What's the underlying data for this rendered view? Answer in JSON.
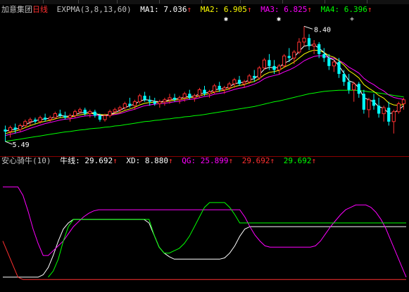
{
  "upper_header": {
    "stock_name": "加意集团",
    "period": "日线",
    "indicator": "EXPMA(3,8,13,60)",
    "ma1": "MA1: 7.036",
    "ma2": "MA2: 6.905",
    "ma3": "MA3: 6.825",
    "ma4": "MA4: 6.396",
    "colors": {
      "name": "#c0c0c0",
      "period": "#ff3030",
      "ma1": "#ffffff",
      "ma2": "#ffff00",
      "ma3": "#ff00ff",
      "ma4": "#00ff00",
      "arrow": "#ff3030"
    }
  },
  "price_labels": {
    "high": "8.40",
    "low": "5.49"
  },
  "lower_header": {
    "indicator": "安心骑牛(10)",
    "niu": "牛线: 29.692",
    "xd": "XD: 8.880",
    "qg": "QG: 25.899",
    "v4": "29.692",
    "v5": "29.692",
    "colors": {
      "name": "#c0c0c0",
      "niu": "#ffffff",
      "xd": "#ffffff",
      "qg": "#ff00ff",
      "v4": "#ff3030",
      "v5": "#00ff00"
    }
  },
  "chart_data": [
    {
      "type": "candlestick",
      "ylim": [
        5.2,
        8.6
      ],
      "high_label": 8.4,
      "low_label": 5.49,
      "series": [
        {
          "name": "MA1",
          "color": "#ffffff"
        },
        {
          "name": "MA2",
          "color": "#ffff00"
        },
        {
          "name": "MA3",
          "color": "#ff00ff"
        },
        {
          "name": "MA4",
          "color": "#00ff00"
        }
      ],
      "candles": [
        [
          5.8,
          5.9,
          5.5,
          5.75
        ],
        [
          5.75,
          5.9,
          5.6,
          5.85
        ],
        [
          5.85,
          5.95,
          5.7,
          5.8
        ],
        [
          5.8,
          5.95,
          5.75,
          5.9
        ],
        [
          5.9,
          6.05,
          5.85,
          6.0
        ],
        [
          6.0,
          6.1,
          5.9,
          6.05
        ],
        [
          6.05,
          6.1,
          5.95,
          6.0
        ],
        [
          6.0,
          6.15,
          5.95,
          6.1
        ],
        [
          6.1,
          6.2,
          6.0,
          6.05
        ],
        [
          6.05,
          6.15,
          6.0,
          6.1
        ],
        [
          6.1,
          6.25,
          6.05,
          6.2
        ],
        [
          6.2,
          6.3,
          6.1,
          6.15
        ],
        [
          6.15,
          6.25,
          6.05,
          6.1
        ],
        [
          6.1,
          6.2,
          6.0,
          6.15
        ],
        [
          6.15,
          6.3,
          6.1,
          6.25
        ],
        [
          6.25,
          6.35,
          6.2,
          6.3
        ],
        [
          6.3,
          6.35,
          6.15,
          6.2
        ],
        [
          6.2,
          6.3,
          6.1,
          6.25
        ],
        [
          6.25,
          6.3,
          6.1,
          6.15
        ],
        [
          6.15,
          6.2,
          6.0,
          6.05
        ],
        [
          6.05,
          6.2,
          6.0,
          6.15
        ],
        [
          6.15,
          6.3,
          6.1,
          6.25
        ],
        [
          6.25,
          6.35,
          6.2,
          6.3
        ],
        [
          6.3,
          6.4,
          6.2,
          6.35
        ],
        [
          6.35,
          6.5,
          6.3,
          6.45
        ],
        [
          6.45,
          6.6,
          6.35,
          6.4
        ],
        [
          6.4,
          6.55,
          6.3,
          6.5
        ],
        [
          6.5,
          6.7,
          6.45,
          6.65
        ],
        [
          6.65,
          6.75,
          6.5,
          6.55
        ],
        [
          6.55,
          6.65,
          6.4,
          6.5
        ],
        [
          6.5,
          6.6,
          6.4,
          6.45
        ],
        [
          6.45,
          6.55,
          6.35,
          6.5
        ],
        [
          6.5,
          6.6,
          6.4,
          6.55
        ],
        [
          6.55,
          6.7,
          6.45,
          6.6
        ],
        [
          6.6,
          6.7,
          6.5,
          6.55
        ],
        [
          6.55,
          6.65,
          6.45,
          6.6
        ],
        [
          6.6,
          6.75,
          6.5,
          6.7
        ],
        [
          6.7,
          6.8,
          6.55,
          6.6
        ],
        [
          6.6,
          6.7,
          6.5,
          6.65
        ],
        [
          6.65,
          6.85,
          6.6,
          6.8
        ],
        [
          6.8,
          6.9,
          6.65,
          6.7
        ],
        [
          6.7,
          6.8,
          6.6,
          6.75
        ],
        [
          6.75,
          6.95,
          6.7,
          6.9
        ],
        [
          6.9,
          7.0,
          6.75,
          6.8
        ],
        [
          6.8,
          6.9,
          6.7,
          6.85
        ],
        [
          6.85,
          7.0,
          6.8,
          6.95
        ],
        [
          6.95,
          7.1,
          6.85,
          7.05
        ],
        [
          7.05,
          7.15,
          6.9,
          6.95
        ],
        [
          6.95,
          7.05,
          6.85,
          7.0
        ],
        [
          7.0,
          7.2,
          6.95,
          7.15
        ],
        [
          7.15,
          7.3,
          7.0,
          7.1
        ],
        [
          7.1,
          7.4,
          7.05,
          7.35
        ],
        [
          7.35,
          7.6,
          7.3,
          7.55
        ],
        [
          7.55,
          7.7,
          7.3,
          7.4
        ],
        [
          7.4,
          7.55,
          7.2,
          7.3
        ],
        [
          7.3,
          7.45,
          7.2,
          7.4
        ],
        [
          7.4,
          7.7,
          7.35,
          7.65
        ],
        [
          7.65,
          7.85,
          7.5,
          7.6
        ],
        [
          7.6,
          7.8,
          7.45,
          7.75
        ],
        [
          7.75,
          8.1,
          7.7,
          8.0
        ],
        [
          8.0,
          8.4,
          7.9,
          8.1
        ],
        [
          8.1,
          8.2,
          7.8,
          7.9
        ],
        [
          7.9,
          8.05,
          7.7,
          7.95
        ],
        [
          7.95,
          8.0,
          7.6,
          7.7
        ],
        [
          7.7,
          7.85,
          7.5,
          7.6
        ],
        [
          7.6,
          7.7,
          7.3,
          7.4
        ],
        [
          7.4,
          7.55,
          7.25,
          7.5
        ],
        [
          7.5,
          7.6,
          7.1,
          7.2
        ],
        [
          7.2,
          7.3,
          6.9,
          7.0
        ],
        [
          7.0,
          7.2,
          6.7,
          6.8
        ],
        [
          6.8,
          7.0,
          6.5,
          6.95
        ],
        [
          6.95,
          7.0,
          6.6,
          6.7
        ],
        [
          6.7,
          6.8,
          6.2,
          6.3
        ],
        [
          6.3,
          6.6,
          6.1,
          6.55
        ],
        [
          6.55,
          6.7,
          6.3,
          6.4
        ],
        [
          6.4,
          6.6,
          6.1,
          6.2
        ],
        [
          6.2,
          6.4,
          6.0,
          6.35
        ],
        [
          6.35,
          6.5,
          5.9,
          6.0
        ],
        [
          6.0,
          6.3,
          5.7,
          6.25
        ],
        [
          6.25,
          6.5,
          6.2,
          6.45
        ],
        [
          6.45,
          6.6,
          6.3,
          6.55
        ]
      ],
      "ma1": [
        5.75,
        5.8,
        5.8,
        5.85,
        5.92,
        5.98,
        6.02,
        6.05,
        6.07,
        6.08,
        6.12,
        6.15,
        6.14,
        6.13,
        6.17,
        6.22,
        6.23,
        6.23,
        6.21,
        6.16,
        6.15,
        6.18,
        6.23,
        6.28,
        6.35,
        6.4,
        6.44,
        6.52,
        6.55,
        6.54,
        6.51,
        6.5,
        6.51,
        6.55,
        6.57,
        6.58,
        6.62,
        6.63,
        6.64,
        6.7,
        6.72,
        6.74,
        6.8,
        6.82,
        6.83,
        6.88,
        6.95,
        6.98,
        6.99,
        7.05,
        7.08,
        7.18,
        7.32,
        7.37,
        7.35,
        7.37,
        7.47,
        7.53,
        7.62,
        7.77,
        7.9,
        7.92,
        7.93,
        7.85,
        7.74,
        7.6,
        7.55,
        7.4,
        7.22,
        7.03,
        6.98,
        6.85,
        6.6,
        6.55,
        6.5,
        6.37,
        6.34,
        6.2,
        6.22,
        6.3,
        6.4
      ],
      "ma2": [
        5.7,
        5.73,
        5.76,
        5.8,
        5.85,
        5.9,
        5.94,
        5.98,
        6.01,
        6.03,
        6.07,
        6.1,
        6.11,
        6.11,
        6.14,
        6.17,
        6.19,
        6.2,
        6.2,
        6.18,
        6.17,
        6.18,
        6.2,
        6.23,
        6.28,
        6.32,
        6.36,
        6.42,
        6.46,
        6.48,
        6.49,
        6.49,
        6.5,
        6.52,
        6.54,
        6.55,
        6.58,
        6.6,
        6.61,
        6.65,
        6.68,
        6.7,
        6.74,
        6.77,
        6.79,
        6.83,
        6.88,
        6.91,
        6.93,
        6.98,
        7.01,
        7.08,
        7.18,
        7.24,
        7.26,
        7.29,
        7.37,
        7.43,
        7.5,
        7.6,
        7.7,
        7.76,
        7.8,
        7.79,
        7.74,
        7.66,
        7.62,
        7.53,
        7.42,
        7.28,
        7.2,
        7.1,
        6.93,
        6.84,
        6.76,
        6.66,
        6.59,
        6.47,
        6.42,
        6.41,
        6.43
      ],
      "ma3": [
        5.65,
        5.68,
        5.71,
        5.74,
        5.78,
        5.83,
        5.87,
        5.91,
        5.95,
        5.98,
        6.01,
        6.04,
        6.06,
        6.07,
        6.09,
        6.12,
        6.14,
        6.15,
        6.16,
        6.15,
        6.15,
        6.16,
        6.18,
        6.2,
        6.24,
        6.28,
        6.31,
        6.36,
        6.4,
        6.42,
        6.44,
        6.45,
        6.46,
        6.48,
        6.5,
        6.51,
        6.54,
        6.56,
        6.57,
        6.6,
        6.63,
        6.65,
        6.69,
        6.71,
        6.73,
        6.77,
        6.81,
        6.84,
        6.86,
        6.9,
        6.94,
        7.0,
        7.08,
        7.13,
        7.16,
        7.19,
        7.25,
        7.3,
        7.36,
        7.44,
        7.53,
        7.59,
        7.64,
        7.66,
        7.65,
        7.61,
        7.59,
        7.54,
        7.47,
        7.37,
        7.3,
        7.22,
        7.09,
        7.0,
        6.93,
        6.84,
        6.77,
        6.67,
        6.61,
        6.58,
        6.56
      ],
      "ma4": [
        5.5,
        5.52,
        5.54,
        5.56,
        5.58,
        5.6,
        5.62,
        5.64,
        5.66,
        5.68,
        5.7,
        5.72,
        5.74,
        5.75,
        5.77,
        5.79,
        5.8,
        5.82,
        5.83,
        5.84,
        5.86,
        5.87,
        5.89,
        5.9,
        5.92,
        5.94,
        5.96,
        5.98,
        6.0,
        6.01,
        6.03,
        6.04,
        6.06,
        6.07,
        6.09,
        6.1,
        6.12,
        6.13,
        6.15,
        6.16,
        6.18,
        6.2,
        6.22,
        6.24,
        6.26,
        6.28,
        6.3,
        6.32,
        6.34,
        6.36,
        6.38,
        6.41,
        6.44,
        6.47,
        6.5,
        6.52,
        6.55,
        6.58,
        6.61,
        6.64,
        6.67,
        6.7,
        6.72,
        6.74,
        6.76,
        6.77,
        6.78,
        6.79,
        6.79,
        6.79,
        6.79,
        6.78,
        6.77,
        6.75,
        6.74,
        6.72,
        6.7,
        6.68,
        6.66,
        6.64,
        6.62
      ]
    },
    {
      "type": "line",
      "ylim": [
        0,
        100
      ],
      "series": [
        {
          "name": "牛线",
          "color": "#ffffff",
          "values": [
            10,
            10,
            10,
            10,
            10,
            10,
            10,
            10,
            12,
            18,
            28,
            40,
            50,
            55,
            58,
            58,
            58,
            58,
            58,
            58,
            58,
            58,
            58,
            58,
            58,
            58,
            58,
            58,
            58,
            55,
            45,
            35,
            30,
            27,
            25,
            25,
            25,
            25,
            25,
            25,
            25,
            25,
            25,
            25,
            26,
            30,
            36,
            44,
            50,
            52,
            52,
            52,
            52,
            52,
            52,
            52,
            52,
            52,
            52,
            52,
            52,
            52,
            52,
            52,
            52,
            52,
            52,
            52,
            52,
            52,
            52,
            52,
            52,
            52,
            52,
            52,
            52,
            52,
            52,
            52,
            52
          ]
        },
        {
          "name": "QG",
          "color": "#ff00ff",
          "values": [
            85,
            85,
            85,
            85,
            78,
            65,
            50,
            38,
            28,
            28,
            32,
            36,
            40,
            46,
            52,
            56,
            60,
            63,
            65,
            66,
            66,
            66,
            66,
            66,
            66,
            66,
            66,
            66,
            66,
            66,
            66,
            66,
            66,
            66,
            66,
            66,
            66,
            66,
            66,
            66,
            66,
            66,
            66,
            66,
            66,
            66,
            66,
            66,
            60,
            52,
            45,
            40,
            36,
            35,
            35,
            35,
            35,
            35,
            35,
            35,
            35,
            35,
            36,
            40,
            46,
            52,
            57,
            62,
            66,
            68,
            70,
            70,
            70,
            68,
            64,
            58,
            50,
            40,
            30,
            20,
            10
          ]
        },
        {
          "name": "green",
          "color": "#00ff00",
          "values": [
            null,
            null,
            null,
            null,
            null,
            null,
            null,
            null,
            null,
            10,
            15,
            25,
            40,
            52,
            58,
            58,
            58,
            58,
            58,
            58,
            58,
            58,
            58,
            58,
            58,
            58,
            58,
            58,
            58,
            58,
            45,
            35,
            30,
            30,
            32,
            34,
            38,
            44,
            52,
            60,
            68,
            72,
            72,
            72,
            72,
            68,
            62,
            55,
            55,
            55,
            55,
            55,
            55,
            55,
            55,
            55,
            55,
            55,
            55,
            55,
            55,
            55,
            55,
            55,
            55,
            55,
            55,
            55,
            55,
            55,
            55,
            55,
            55,
            55,
            55,
            55,
            55,
            55,
            55,
            55,
            55
          ]
        },
        {
          "name": "red",
          "color": "#ff3030",
          "values": [
            40,
            30,
            20,
            10,
            8,
            8,
            8,
            8,
            8,
            8,
            8,
            8,
            8,
            8,
            8,
            8,
            8,
            8,
            8,
            8,
            8,
            8,
            8,
            8,
            8,
            8,
            8,
            8,
            8,
            8,
            8,
            8,
            8,
            8,
            8,
            8,
            8,
            8,
            8,
            8,
            8,
            8,
            8,
            8,
            8,
            8,
            8,
            8,
            8,
            8,
            8,
            8,
            8,
            8,
            8,
            8,
            8,
            8,
            8,
            8,
            8,
            8,
            8,
            8,
            8,
            8,
            8,
            8,
            8,
            8,
            8,
            8,
            8,
            8,
            8,
            8,
            8,
            8,
            8,
            8,
            8
          ]
        }
      ]
    }
  ]
}
